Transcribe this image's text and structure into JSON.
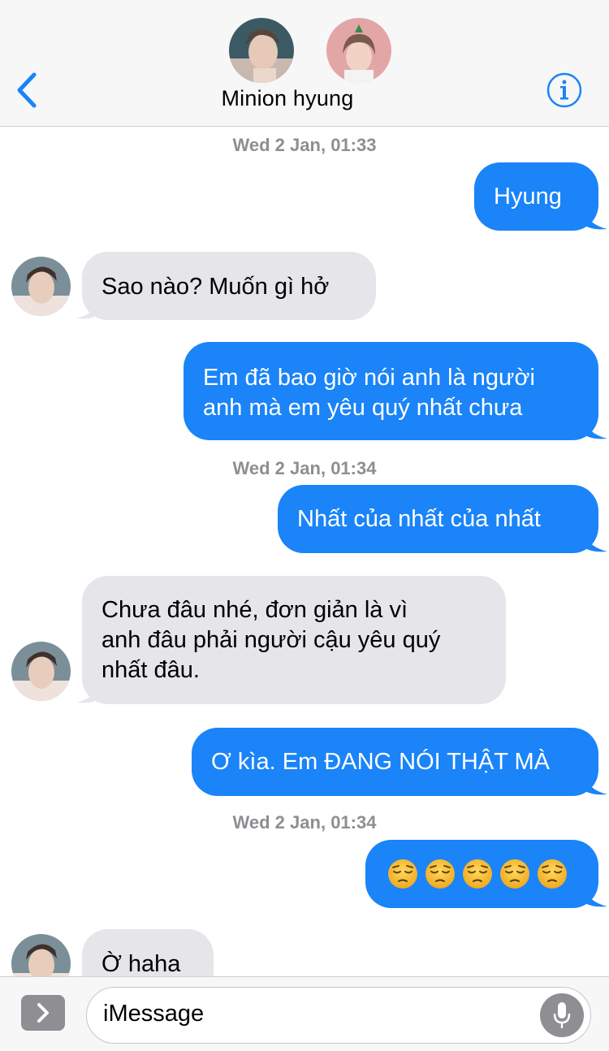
{
  "header": {
    "contact_name": "Minion hyung",
    "back_icon": "chevron-left-icon",
    "info_icon": "info-icon",
    "accent_color": "#1a84f8"
  },
  "thread": {
    "timestamps": [
      {
        "day": "Wed 2 Jan,",
        "time": "01:33"
      },
      {
        "day": "Wed 2 Jan,",
        "time": "01:34"
      },
      {
        "day": "Wed 2 Jan,",
        "time": "01:34"
      }
    ],
    "messages": [
      {
        "direction": "outgoing",
        "lines": [
          "Hyung"
        ]
      },
      {
        "direction": "incoming",
        "lines": [
          "Sao nào? Muốn gì hở"
        ]
      },
      {
        "direction": "outgoing",
        "lines": [
          "Em đã bao giờ nói anh là người",
          "anh mà em yêu quý nhất chưa"
        ]
      },
      {
        "direction": "outgoing",
        "lines": [
          "Nhất của nhất của nhất"
        ]
      },
      {
        "direction": "incoming",
        "lines": [
          "Chưa đâu nhé, đơn giản là vì",
          "anh đâu phải người cậu yêu quý",
          "nhất đâu."
        ]
      },
      {
        "direction": "outgoing",
        "lines": [
          "Ơ kìa. Em ĐANG NÓI THẬT MÀ"
        ]
      },
      {
        "direction": "outgoing",
        "emoji_name": "pensive-face-emoji",
        "emoji_count": 5
      },
      {
        "direction": "incoming",
        "lines": [
          "Ờ haha"
        ]
      }
    ],
    "outgoing_color": "#1a84f8",
    "incoming_color": "#e5e5ea"
  },
  "input": {
    "placeholder": "iMessage",
    "apps_icon": "chevron-right-icon",
    "mic_icon": "microphone-icon"
  }
}
